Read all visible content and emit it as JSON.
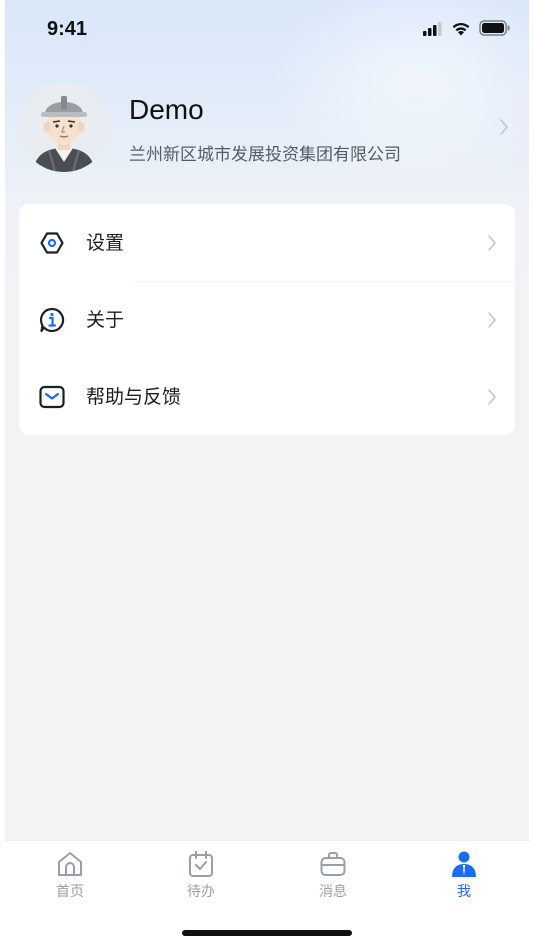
{
  "status_bar": {
    "time": "9:41"
  },
  "profile": {
    "name": "Demo",
    "company": "兰州新区城市发展投资集团有限公司"
  },
  "menu": {
    "items": [
      {
        "label": "设置",
        "icon": "settings-hex-icon"
      },
      {
        "label": "关于",
        "icon": "info-bubble-icon"
      },
      {
        "label": "帮助与反馈",
        "icon": "feedback-envelope-icon"
      }
    ]
  },
  "tab_bar": {
    "tabs": [
      {
        "label": "首页",
        "icon": "home-icon",
        "active": false
      },
      {
        "label": "待办",
        "icon": "todo-calendar-icon",
        "active": false
      },
      {
        "label": "消息",
        "icon": "message-briefcase-icon",
        "active": false
      },
      {
        "label": "我",
        "icon": "profile-person-icon",
        "active": true
      }
    ]
  },
  "colors": {
    "accent": "#1a6cf0",
    "inactive": "#9a9ea6",
    "background": "#f2f3f5"
  }
}
